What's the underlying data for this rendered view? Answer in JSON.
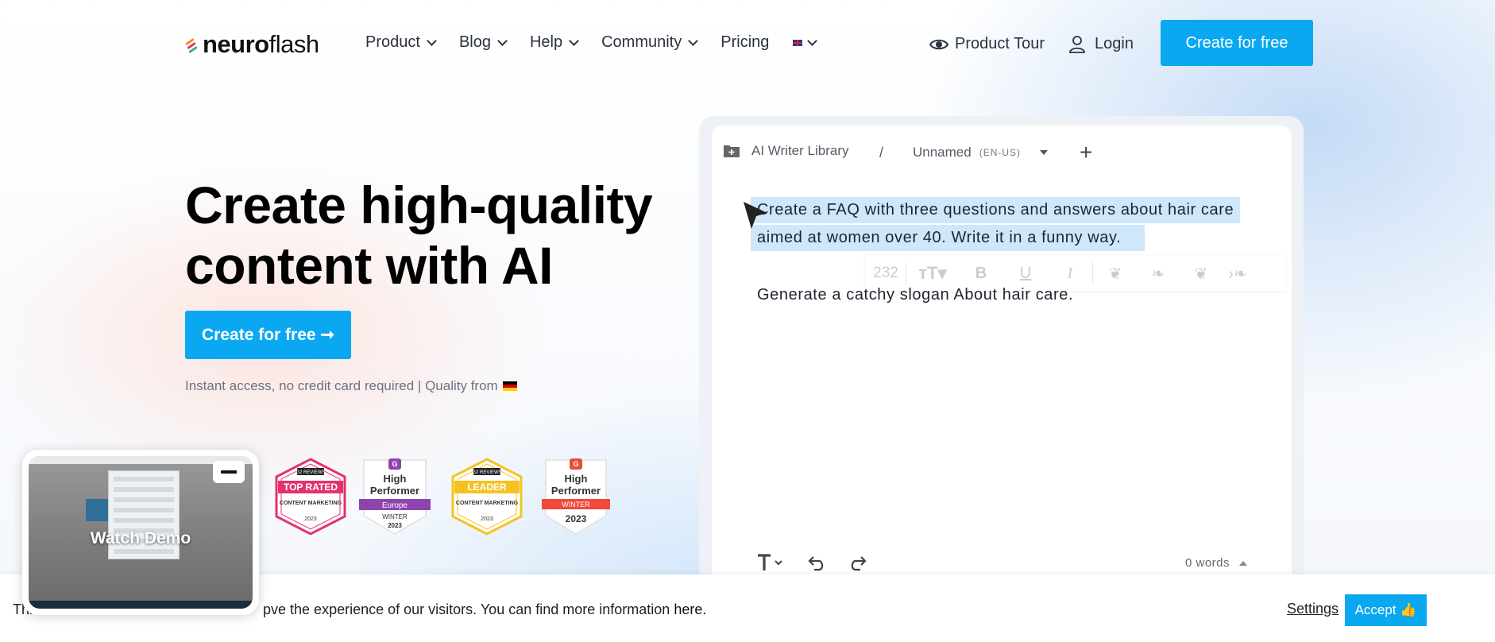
{
  "nav": {
    "logo_bold": "neuro",
    "logo_light": "flash",
    "items": [
      {
        "label": "Product"
      },
      {
        "label": "Blog"
      },
      {
        "label": "Help"
      },
      {
        "label": "Community"
      },
      {
        "label": "Pricing"
      }
    ],
    "product_tour": "Product Tour",
    "login": "Login",
    "cta": "Create for free"
  },
  "hero": {
    "title_line1": "Create high-quality",
    "title_line2": "content with AI",
    "cta": "Create for free ➞",
    "subtitle": "Instant access, no credit card required | Quality from"
  },
  "badges": [
    {
      "brand": "G2 REVIEWS",
      "title": "TOP RATED",
      "subtitle": "CONTENT MARKETING",
      "year": "2023",
      "color": "#e5316d"
    },
    {
      "title_1": "High",
      "title_2": "Performer",
      "ribbon": "Europe",
      "season": "WINTER",
      "year": "2023",
      "color": "#8e44ad"
    },
    {
      "brand": "G2 REVIEWS",
      "title": "LEADER",
      "subtitle": "CONTENT MARKETING",
      "year": "2023",
      "color": "#f5c320"
    },
    {
      "title_1": "High",
      "title_2": "Performer",
      "ribbon": "WINTER",
      "year": "2023",
      "color": "#ef4a3a"
    }
  ],
  "editor": {
    "library": "AI Writer Library",
    "separator": "/",
    "doc_name": "Unnamed",
    "lang": "(EN-US)",
    "prompt_line1": "Create a FAQ with three questions and answers about hair care",
    "prompt_line2": "aimed at women over 40. Write it in a funny way.",
    "prompt2": "Generate a catchy slogan About hair care.",
    "toolbar_count": "232",
    "word_count": "0 words"
  },
  "cookie": {
    "text_start": "Thi",
    "text_mid": "pve the experience of our visitors. You can find more information ",
    "link": "here",
    "text_end": ".",
    "settings": "Settings",
    "accept": "Accept 👍"
  },
  "demo": {
    "label": "Watch Demo"
  },
  "colors": {
    "accent": "#0aa8f0",
    "selection": "#cfe7fb"
  },
  "icons": [
    "eye-icon",
    "user-icon",
    "folder-icon",
    "plus-icon",
    "undo-icon",
    "redo-icon",
    "text-format-icon"
  ]
}
